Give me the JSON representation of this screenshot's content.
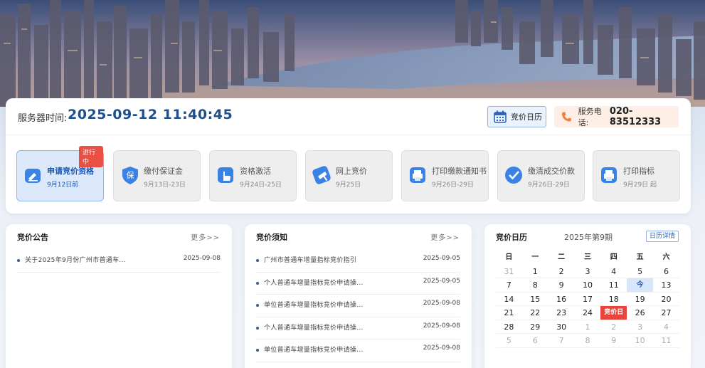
{
  "header": {
    "server_label": "服务器时间:",
    "server_time": "2025-09-12 11:40:45",
    "calendar_button": "竞价日历",
    "phone_label": "服务电话:",
    "phone_number": "020-83512333"
  },
  "steps": [
    {
      "title": "申请竞价资格",
      "date": "9月12日前",
      "badge": "进行中",
      "active": true
    },
    {
      "title": "缴付保证金",
      "date": "9月13日-23日"
    },
    {
      "title": "资格激活",
      "date": "9月24日-25日"
    },
    {
      "title": "网上竞价",
      "date": "9月25日"
    },
    {
      "title": "打印缴款通知书",
      "date": "9月26日-29日"
    },
    {
      "title": "缴清成交价款",
      "date": "9月26日-29日"
    },
    {
      "title": "打印指标",
      "date": "9月29日 起"
    }
  ],
  "announcements": {
    "title": "竞价公告",
    "more": "更多>>",
    "items": [
      {
        "text": "关于2025年9月份广州市普通车...",
        "date": "2025-09-08"
      }
    ]
  },
  "notices": {
    "title": "竞价须知",
    "more": "更多>>",
    "items": [
      {
        "text": "广州市普通车增量指标竞价指引",
        "date": "2025-09-05"
      },
      {
        "text": "个人普通车增量指标竞价申请操...",
        "date": "2025-09-05"
      },
      {
        "text": "单位普通车增量指标竞价申请操...",
        "date": "2025-09-08"
      },
      {
        "text": "个人普通车增量指标竞价申请操...",
        "date": "2025-09-08"
      },
      {
        "text": "单位普通车增量指标竞价申请操...",
        "date": "2025-09-08"
      }
    ]
  },
  "calendar": {
    "title": "竞价日历",
    "month": "2025年第9期",
    "detail": "日历详情",
    "weekdays": [
      "日",
      "一",
      "二",
      "三",
      "四",
      "五",
      "六"
    ],
    "rows": [
      [
        "31",
        "1",
        "2",
        "3",
        "4",
        "5",
        "6"
      ],
      [
        "7",
        "8",
        "9",
        "10",
        "11",
        "今",
        "13"
      ],
      [
        "14",
        "15",
        "16",
        "17",
        "18",
        "19",
        "20"
      ],
      [
        "21",
        "22",
        "23",
        "24",
        "竞价日",
        "26",
        "27"
      ],
      [
        "28",
        "29",
        "30",
        "1",
        "2",
        "3",
        "4"
      ],
      [
        "5",
        "6",
        "7",
        "8",
        "9",
        "10",
        "11"
      ]
    ]
  },
  "colors": {
    "accent": "#1a56b8",
    "bid_day": "#e8453c",
    "today_bg": "#d7e6fa",
    "badge": "#e94f43"
  }
}
